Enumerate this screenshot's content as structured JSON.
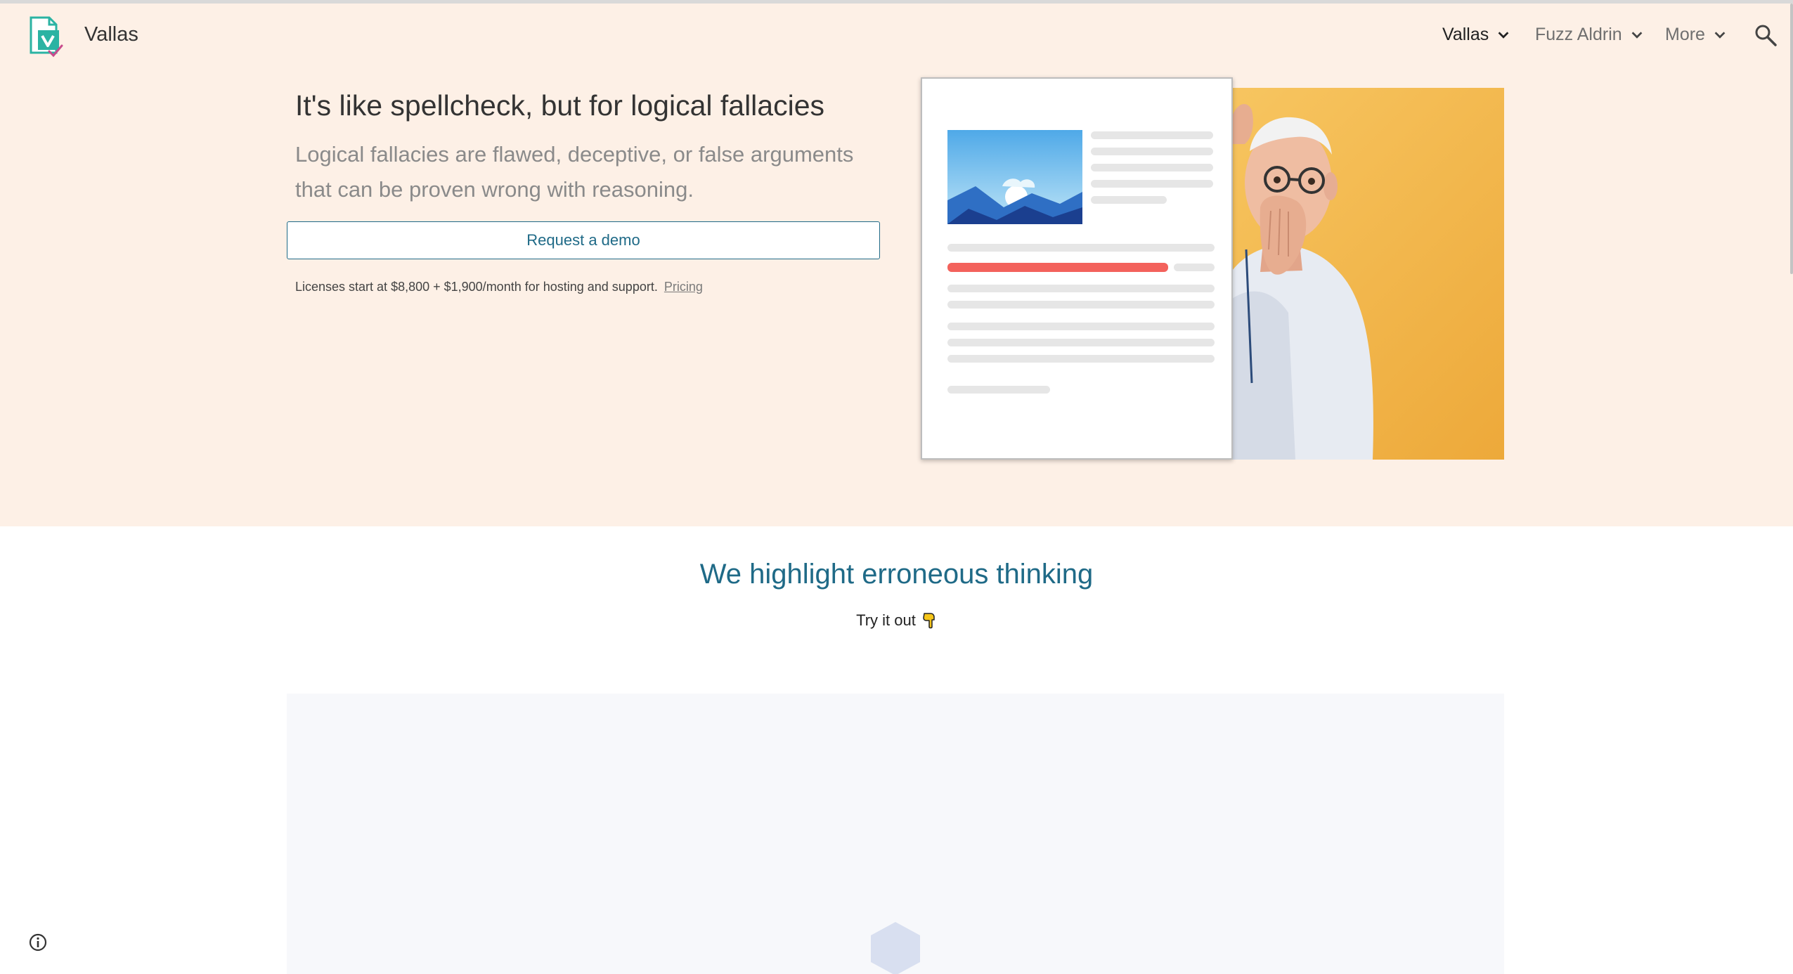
{
  "site": {
    "title": "Vallas"
  },
  "nav": {
    "items": [
      {
        "label": "Vallas",
        "active": true
      },
      {
        "label": "Fuzz Aldrin",
        "active": false
      },
      {
        "label": "More",
        "active": false
      }
    ],
    "search_icon": "search-icon"
  },
  "hero": {
    "headline": "It's like spellcheck, but for logical fallacies",
    "subtitle": "Logical fallacies are flawed, deceptive, or false arguments that can be proven wrong with reasoning.",
    "cta_label": "Request a demo",
    "pricing_text": "Licenses start at $8,800 + $1,900/month for hosting and support.",
    "pricing_link": "Pricing"
  },
  "section": {
    "title": "We highlight erroneous thinking",
    "try_label": "Try it out",
    "try_icon": "pointing-down-hand-icon"
  },
  "colors": {
    "hero_background": "#fdf0e6",
    "accent": "#1f6a87",
    "highlight_red": "#f3625c",
    "illustration_yellow": "#f4b94d",
    "embed_background": "#f7f8fb"
  }
}
